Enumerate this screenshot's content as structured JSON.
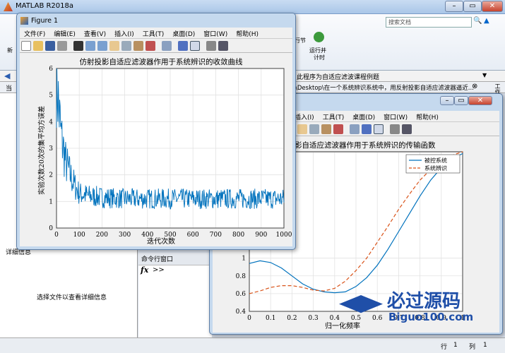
{
  "app": {
    "title": "MATLAB R2018a",
    "search_placeholder": "搜索文档"
  },
  "ribbon": {
    "new_label": "新",
    "section_label": "行节",
    "run_advance_label": "运行并\n计时",
    "run_advance_l1": "运行并",
    "run_advance_l2": "计时"
  },
  "address": {
    "folder_text": "此程序为自适应滤波课程例题",
    "path_text": "\\Desktop\\在一个系统辨识系统中，用反射投影自适应滤波器逼近...",
    "left_label": "当"
  },
  "left_panel": {
    "details_header": "详细信息",
    "details_text": "选择文件以查看详细信息"
  },
  "command_window": {
    "header": "命令行窗口",
    "fx": "fx",
    "prompt": ">>"
  },
  "status": {
    "row_label": "行",
    "row_value": "1",
    "col_label": "列",
    "col_value": "1"
  },
  "workspace_tab": "工作区",
  "fig1": {
    "title": "Figure 1",
    "menu": [
      "文件(F)",
      "编辑(E)",
      "查看(V)",
      "插入(I)",
      "工具(T)",
      "桌面(D)",
      "窗口(W)",
      "帮助(H)"
    ],
    "chart_title": "仿射投影自适应滤波器作用于系统辨识的收敛曲线",
    "xlabel": "迭代次数",
    "ylabel": "实验次数20次的集平均方误差"
  },
  "fig2": {
    "menu": [
      "插入(I)",
      "工具(T)",
      "桌面(D)",
      "窗口(W)",
      "帮助(H)"
    ],
    "chart_title": "仿射投影自适应滤波器作用于系统辨识的传输函数",
    "xlabel": "归一化频率"
  },
  "watermark": {
    "brand": "必过源码",
    "url": "Biguo100.com"
  },
  "chart_data": [
    {
      "type": "line",
      "title": "仿射投影自适应滤波器作用于系统辨识的收敛曲线",
      "xlabel": "迭代次数",
      "ylabel": "实验次数20次的集平均方误差",
      "xlim": [
        0,
        1000
      ],
      "ylim": [
        0,
        6
      ],
      "xticks": [
        0,
        100,
        200,
        300,
        400,
        500,
        600,
        700,
        800,
        900,
        1000
      ],
      "yticks": [
        0,
        1,
        2,
        3,
        4,
        5,
        6
      ],
      "grid": true,
      "series": [
        {
          "color": "#0072bd",
          "x": [
            0,
            10,
            20,
            30,
            40,
            60,
            80,
            100,
            150,
            200,
            300,
            400,
            500,
            600,
            700,
            800,
            900,
            1000
          ],
          "y": [
            5.8,
            4.5,
            3.5,
            3.0,
            2.5,
            2.0,
            1.6,
            1.3,
            1.2,
            1.15,
            1.1,
            1.1,
            1.1,
            1.1,
            1.1,
            1.1,
            1.1,
            1.1
          ]
        }
      ]
    },
    {
      "type": "line",
      "title": "仿射投影自适应滤波器作用于系统辨识的传输函数",
      "xlabel": "归一化频率",
      "xlim": [
        0,
        1
      ],
      "ylim": [
        0.4,
        2.2
      ],
      "xticks": [
        0,
        0.1,
        0.2,
        0.3,
        0.4,
        0.5,
        0.6,
        0.7,
        0.8,
        0.9,
        1
      ],
      "yticks": [
        0.4,
        0.6,
        0.8,
        1
      ],
      "grid": true,
      "legend_position": "top-right",
      "series": [
        {
          "name": "被控系统",
          "color": "#0072bd",
          "style": "solid",
          "x": [
            0,
            0.05,
            0.1,
            0.15,
            0.2,
            0.25,
            0.3,
            0.35,
            0.4,
            0.45,
            0.5,
            0.55,
            0.6,
            0.65,
            0.7,
            0.75,
            0.8,
            0.85,
            0.9,
            0.95,
            1
          ],
          "y": [
            0.94,
            0.97,
            0.95,
            0.89,
            0.8,
            0.71,
            0.65,
            0.62,
            0.61,
            0.62,
            0.68,
            0.78,
            0.92,
            1.1,
            1.3,
            1.5,
            1.7,
            1.88,
            2.02,
            2.12,
            2.18
          ]
        },
        {
          "name": "系统辨识",
          "color": "#d95319",
          "style": "dashed",
          "x": [
            0,
            0.05,
            0.1,
            0.15,
            0.2,
            0.25,
            0.3,
            0.35,
            0.4,
            0.45,
            0.5,
            0.55,
            0.6,
            0.65,
            0.7,
            0.75,
            0.8,
            0.85,
            0.9,
            0.95,
            1
          ],
          "y": [
            0.6,
            0.63,
            0.67,
            0.69,
            0.69,
            0.67,
            0.64,
            0.63,
            0.66,
            0.74,
            0.86,
            1.0,
            1.18,
            1.36,
            1.55,
            1.72,
            1.88,
            2.0,
            2.1,
            2.16,
            2.2
          ]
        }
      ]
    }
  ]
}
